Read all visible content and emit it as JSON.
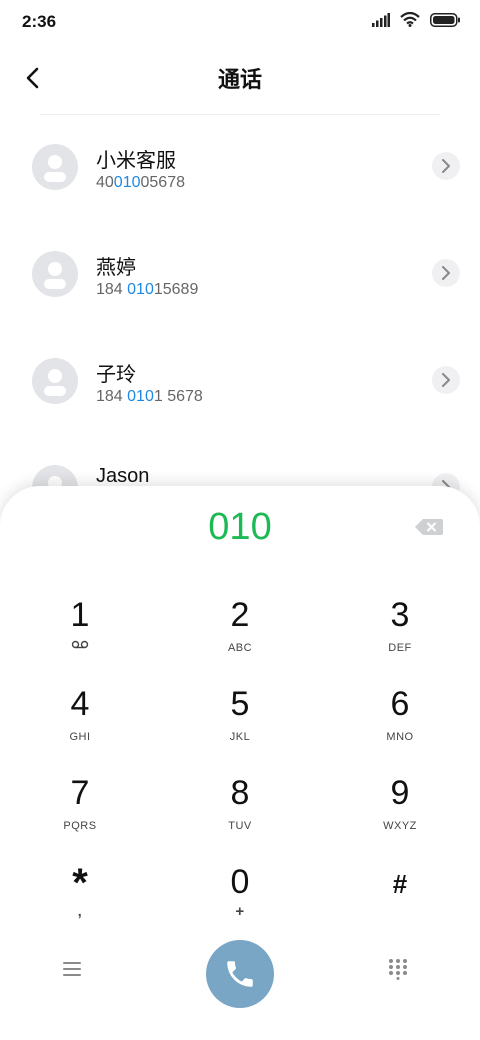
{
  "status_bar": {
    "time": "2:36"
  },
  "header": {
    "title": "通话"
  },
  "contacts": [
    {
      "name": "小米客服",
      "num_pre": "40",
      "num_hl": "010",
      "num_post": "05678"
    },
    {
      "name": "燕婷",
      "num_pre": "184 ",
      "num_hl": "010",
      "num_post": "15689"
    },
    {
      "name": "子玲",
      "num_pre": "184 ",
      "num_hl": "010",
      "num_post": "1 5678"
    },
    {
      "name": "Jason",
      "num_pre": "",
      "num_hl": "",
      "num_post": ""
    }
  ],
  "dialpad": {
    "dialed": "010",
    "keys": [
      {
        "digit": "1",
        "letters": ""
      },
      {
        "digit": "2",
        "letters": "ABC"
      },
      {
        "digit": "3",
        "letters": "DEF"
      },
      {
        "digit": "4",
        "letters": "GHI"
      },
      {
        "digit": "5",
        "letters": "JKL"
      },
      {
        "digit": "6",
        "letters": "MNO"
      },
      {
        "digit": "7",
        "letters": "PQRS"
      },
      {
        "digit": "8",
        "letters": "TUV"
      },
      {
        "digit": "9",
        "letters": "WXYZ"
      },
      {
        "digit": "*",
        "letters": ","
      },
      {
        "digit": "0",
        "letters": "+"
      },
      {
        "digit": "#",
        "letters": ""
      }
    ]
  },
  "colors": {
    "dialed": "#1db954",
    "highlight": "#1e88e5",
    "call_button": "#7aa6c5"
  }
}
